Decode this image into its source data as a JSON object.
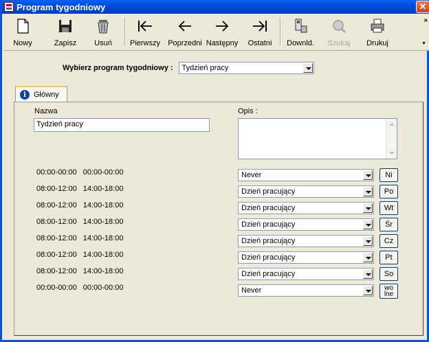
{
  "window": {
    "title": "Program tygodniowy",
    "close_symbol": "✕"
  },
  "toolbar": {
    "buttons": [
      {
        "label": "Nowy",
        "icon": "new-file-icon",
        "enabled": true
      },
      {
        "label": "Zapisz",
        "icon": "floppy-disk-icon",
        "enabled": true
      },
      {
        "label": "Usuń",
        "icon": "trash-can-icon",
        "enabled": true
      },
      {
        "label": "Pierwszy",
        "icon": "first-arrow-icon",
        "enabled": true
      },
      {
        "label": "Poprzedni",
        "icon": "left-arrow-icon",
        "enabled": true
      },
      {
        "label": "Następny",
        "icon": "right-arrow-icon",
        "enabled": true
      },
      {
        "label": "Ostatni",
        "icon": "last-arrow-icon",
        "enabled": true
      },
      {
        "label": "Downld.",
        "icon": "download-device-icon",
        "enabled": true
      },
      {
        "label": "Szukaj",
        "icon": "search-icon",
        "enabled": false
      },
      {
        "label": "Drukuj",
        "icon": "printer-icon",
        "enabled": true
      }
    ],
    "overflow": "»"
  },
  "program_select": {
    "label": "Wybierz program tygodniowy :",
    "value": "Tydzień pracy"
  },
  "tab": {
    "label": "Główny",
    "icon": "info-icon"
  },
  "form": {
    "name_label": "Nazwa",
    "name_value": "Tydzień pracy",
    "desc_label": "Opis :",
    "desc_value": ""
  },
  "days": [
    {
      "t1": "00:00-00:00",
      "t2": "00:00-00:00",
      "type": "Never",
      "button": "Ni"
    },
    {
      "t1": "08:00-12:00",
      "t2": "14:00-18:00",
      "type": "Dzień pracujący",
      "button": "Po"
    },
    {
      "t1": "08:00-12:00",
      "t2": "14:00-18:00",
      "type": "Dzień pracujący",
      "button": "Wt"
    },
    {
      "t1": "08:00-12:00",
      "t2": "14:00-18:00",
      "type": "Dzień pracujący",
      "button": "Śr"
    },
    {
      "t1": "08:00-12:00",
      "t2": "14:00-18:00",
      "type": "Dzień pracujący",
      "button": "Cz"
    },
    {
      "t1": "08:00-12:00",
      "t2": "14:00-18:00",
      "type": "Dzień pracujący",
      "button": "Pt"
    },
    {
      "t1": "08:00-12:00",
      "t2": "14:00-18:00",
      "type": "Dzień pracujący",
      "button": "So"
    },
    {
      "t1": "00:00-00:00",
      "t2": "00:00-00:00",
      "type": "Never",
      "button": "wo lne"
    }
  ]
}
